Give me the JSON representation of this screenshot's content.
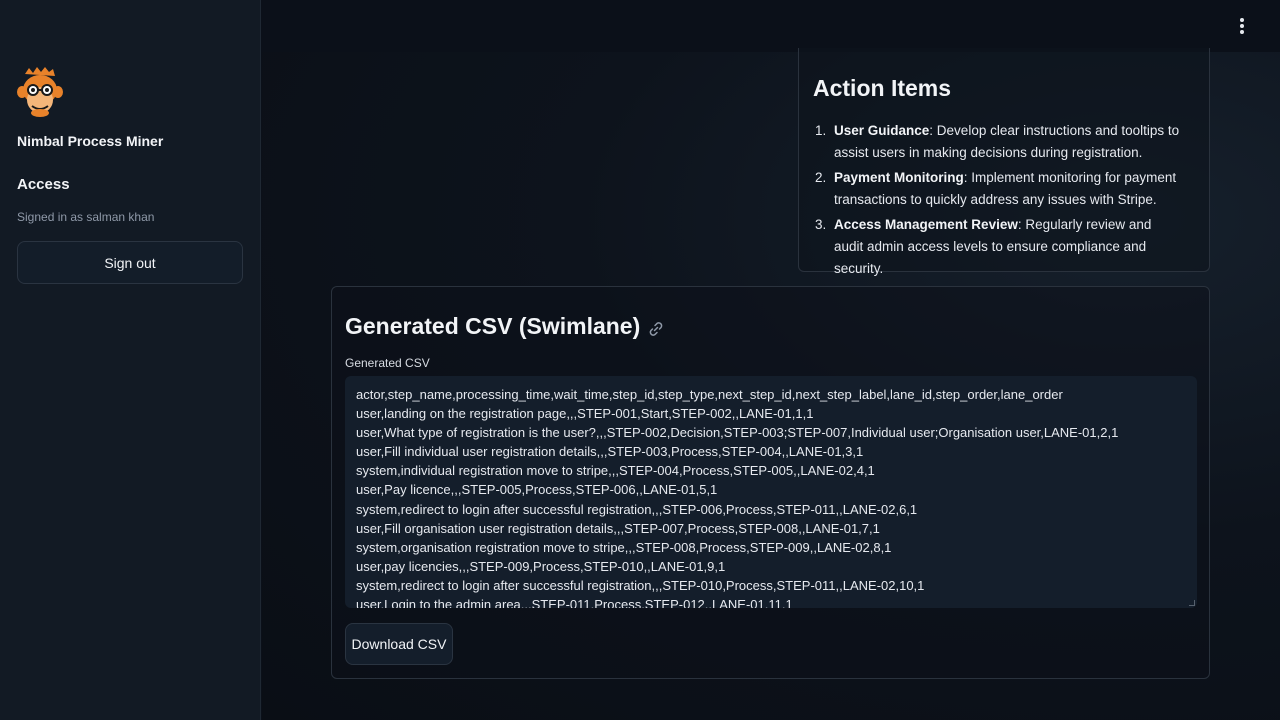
{
  "sidebar": {
    "app_name": "Nimbal Process Miner",
    "access_title": "Access",
    "signed_in": "Signed in as salman khan",
    "sign_out": "Sign out"
  },
  "action_items": {
    "title": "Action Items",
    "items": [
      {
        "num": "1.",
        "bold": "User Guidance",
        "text": ": Develop clear instructions and tooltips to assist users in making decisions during registration."
      },
      {
        "num": "2.",
        "bold": "Payment Monitoring",
        "text": ": Implement monitoring for payment transactions to quickly address any issues with Stripe."
      },
      {
        "num": "3.",
        "bold": "Access Management Review",
        "text": ": Regularly review and audit admin access levels to ensure compliance and security."
      }
    ]
  },
  "csv_section": {
    "title": "Generated CSV (Swimlane)",
    "label": "Generated CSV",
    "content": "actor,step_name,processing_time,wait_time,step_id,step_type,next_step_id,next_step_label,lane_id,step_order,lane_order\nuser,landing on the registration page,,,STEP-001,Start,STEP-002,,LANE-01,1,1\nuser,What type of registration is the user?,,,STEP-002,Decision,STEP-003;STEP-007,Individual user;Organisation user,LANE-01,2,1\nuser,Fill individual user registration details,,,STEP-003,Process,STEP-004,,LANE-01,3,1\nsystem,individual registration move to stripe,,,STEP-004,Process,STEP-005,,LANE-02,4,1\nuser,Pay licence,,,STEP-005,Process,STEP-006,,LANE-01,5,1\nsystem,redirect to login after successful registration,,,STEP-006,Process,STEP-011,,LANE-02,6,1\nuser,Fill organisation user registration details,,,STEP-007,Process,STEP-008,,LANE-01,7,1\nsystem,organisation registration move to stripe,,,STEP-008,Process,STEP-009,,LANE-02,8,1\nuser,pay licencies,,,STEP-009,Process,STEP-010,,LANE-01,9,1\nsystem,redirect to login after successful registration,,,STEP-010,Process,STEP-011,,LANE-02,10,1\nuser,Login to the admin area,,,STEP-011,Process,STEP-012,,LANE-01,11,1",
    "download": "Download CSV"
  },
  "icons": {
    "logo": "monkey-logo-icon",
    "menu": "kebab-menu-icon",
    "anchor": "link-icon"
  },
  "colors": {
    "background": "#0b1019",
    "sidebar": "#121a24",
    "logo_orange": "#e8822a"
  }
}
